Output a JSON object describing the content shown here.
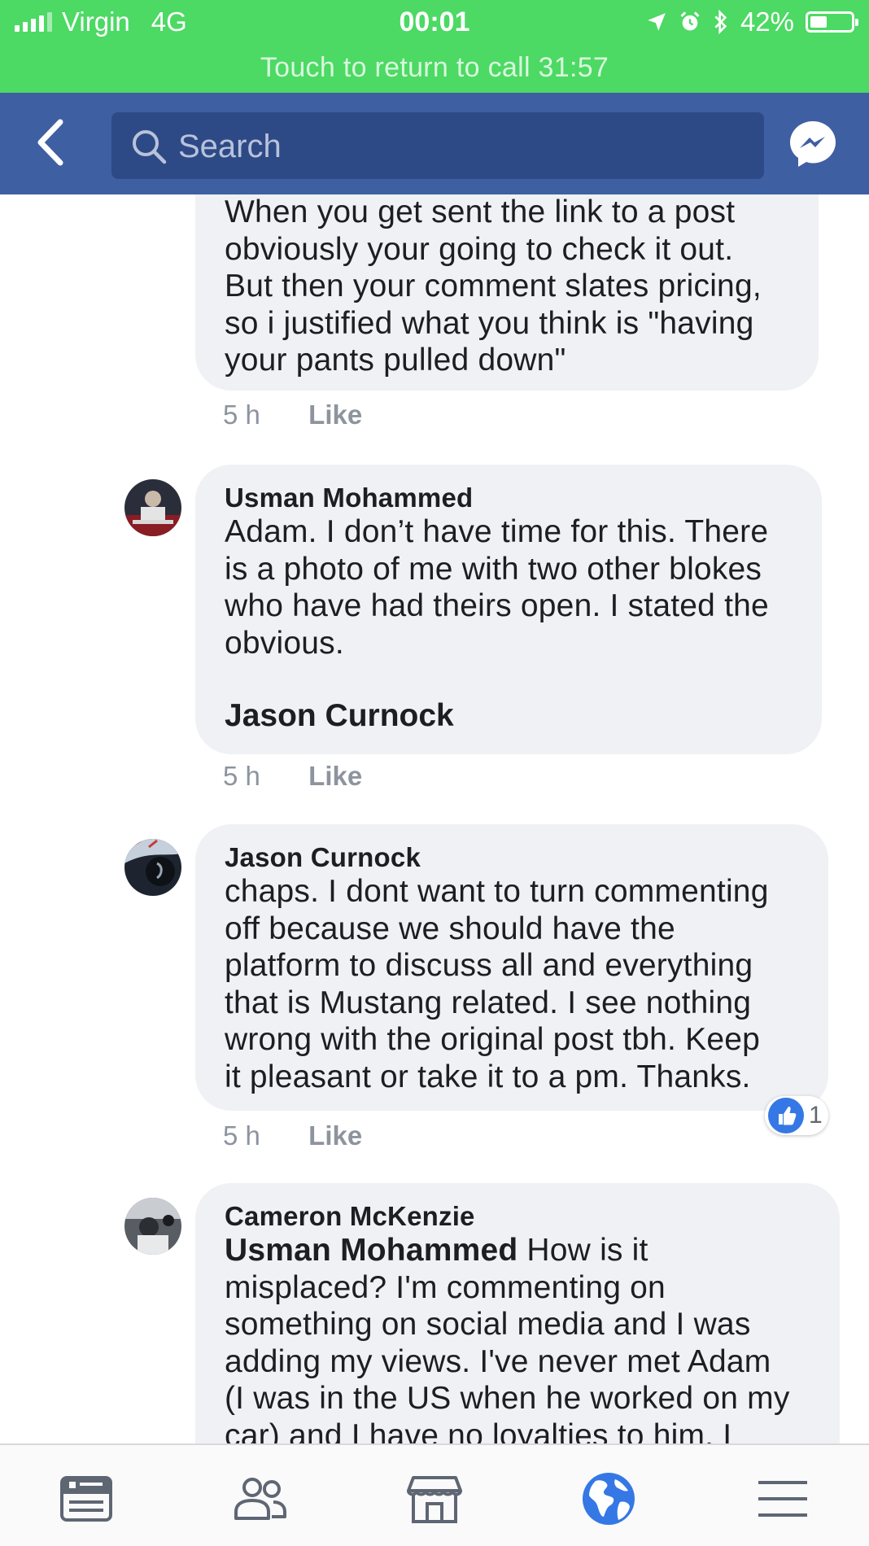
{
  "status_bar": {
    "carrier": "Virgin",
    "network": "4G",
    "time": "00:01",
    "battery": "42%",
    "battery_level": 0.42,
    "call_banner": "Touch to return to call 31:57"
  },
  "nav": {
    "search_placeholder": "Search"
  },
  "comments": [
    {
      "lines": [
        "When you get sent the link to a post",
        "obviously your going to check it out.",
        "But then your comment slates pricing,",
        "so i justified what you think is \"having",
        "your pants pulled down\""
      ],
      "time": "5 h",
      "like_label": "Like"
    },
    {
      "author": "Usman Mohammed",
      "lines": [
        "Adam. I don’t have time for this. There",
        "is a photo of me with two other blokes",
        "who have had theirs open. I stated the",
        "obvious."
      ],
      "mention": "Jason Curnock",
      "time": "5 h",
      "like_label": "Like"
    },
    {
      "author": "Jason Curnock",
      "lines": [
        "chaps. I dont want to turn commenting",
        "off because we should have the",
        "platform to discuss all and everything",
        "that is Mustang related. I see nothing",
        "wrong with the original post tbh. Keep",
        "it pleasant or take it to a pm. Thanks."
      ],
      "time": "5 h",
      "like_label": "Like",
      "reaction_count": "1"
    },
    {
      "author": "Cameron McKenzie",
      "mention": "Usman Mohammed",
      "first_line_rest": " How is it",
      "lines": [
        "misplaced? I'm commenting on",
        "something on social media and I was",
        "adding my views. I've never met Adam",
        "(I was in the US when he worked on my",
        "car) and I have no loyalties to him. I"
      ]
    }
  ],
  "tabs": [
    {
      "name": "news-feed-icon",
      "active": false
    },
    {
      "name": "friends-icon",
      "active": false
    },
    {
      "name": "marketplace-icon",
      "active": false
    },
    {
      "name": "notifications-globe-icon",
      "active": true
    },
    {
      "name": "menu-icon",
      "active": false
    }
  ],
  "colors": {
    "call_green": "#4cd964",
    "nav_blue": "#3f5fa3",
    "search_blue": "#2e4a86",
    "active_tab": "#3578e5",
    "bubble": "#f0f1f4"
  }
}
